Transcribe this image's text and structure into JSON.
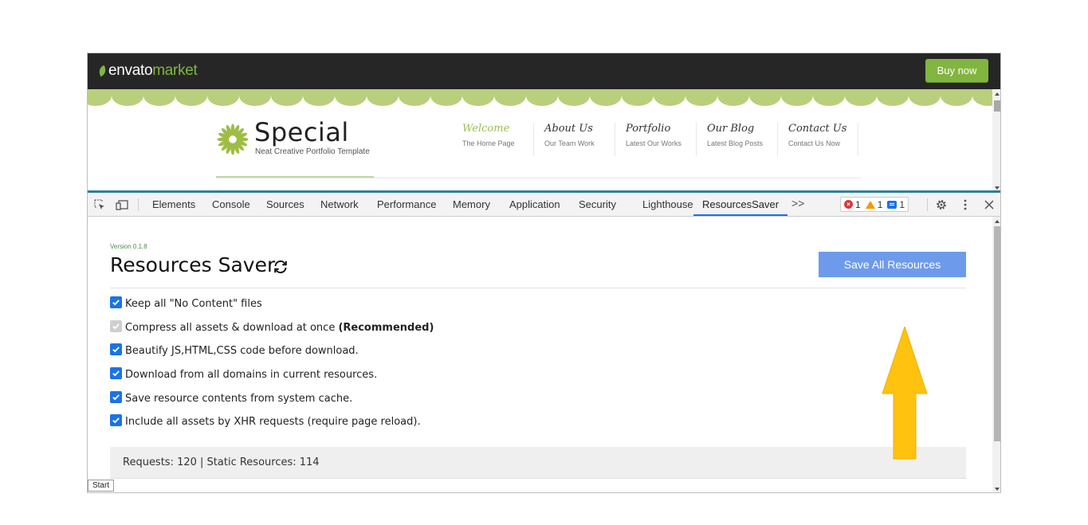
{
  "envato": {
    "logo_word1": "envato",
    "logo_word2": "market",
    "buy_now": "Buy now"
  },
  "site": {
    "title": "Special",
    "tagline": "Neat Creative Portfolio Template",
    "nav": [
      {
        "title": "Welcome",
        "sub": "The Home Page"
      },
      {
        "title": "About Us",
        "sub": "Our Team Work"
      },
      {
        "title": "Portfolio",
        "sub": "Latest Our Works"
      },
      {
        "title": "Our Blog",
        "sub": "Latest Blog Posts"
      },
      {
        "title": "Contact Us",
        "sub": "Contact Us Now"
      }
    ]
  },
  "devtools": {
    "tabs": [
      "Elements",
      "Console",
      "Sources",
      "Network",
      "Performance",
      "Memory",
      "Application",
      "Security",
      "Lighthouse",
      "ResourcesSaver"
    ],
    "active_tab": "ResourcesSaver",
    "more": ">>",
    "errors": "1",
    "warnings": "1",
    "messages": "1"
  },
  "panel": {
    "version": "Version 0.1.8",
    "title": "Resources Saver",
    "save_all": "Save All Resources",
    "options": [
      {
        "label": "Keep all \"No Content\" files",
        "checked": true,
        "disabled": false,
        "bold": ""
      },
      {
        "label": "Compress all assets & download at once ",
        "checked": true,
        "disabled": true,
        "bold": "(Recommended)"
      },
      {
        "label": "Beautify JS,HTML,CSS code before download.",
        "checked": true,
        "disabled": false,
        "bold": ""
      },
      {
        "label": "Download from all domains in current resources.",
        "checked": true,
        "disabled": false,
        "bold": ""
      },
      {
        "label": "Save resource contents from system cache.",
        "checked": true,
        "disabled": false,
        "bold": ""
      },
      {
        "label": "Include all assets by XHR requests (require page reload).",
        "checked": true,
        "disabled": false,
        "bold": ""
      }
    ],
    "stats": "Requests: 120 | Static Resources: 114"
  },
  "start_tag": "Start",
  "colors": {
    "envato_green": "#82b540",
    "devtools_accent": "#1a73e8",
    "save_button": "#6e9aec",
    "annotation_arrow": "#ffc20e"
  }
}
